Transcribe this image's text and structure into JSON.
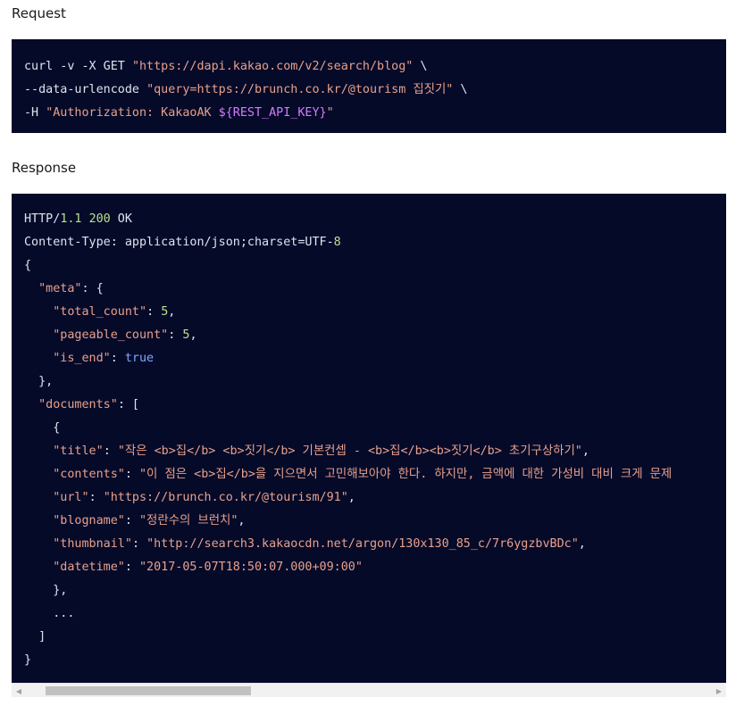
{
  "request": {
    "label": "Request",
    "lines": [
      [
        "curl -v -X GET ",
        "\"https://dapi.kakao.com/v2/search/blog\"",
        " \\"
      ],
      [
        "--data-urlencode ",
        "\"query=https://brunch.co.kr/@tourism 집짓기\"",
        " \\"
      ],
      [
        "-H ",
        "\"Authorization: KakaoAK ",
        "${REST_API_KEY}",
        "\""
      ]
    ]
  },
  "response": {
    "label": "Response",
    "status": {
      "protocol": "HTTP/",
      "version": "1.1",
      "code": "200",
      "text": " OK"
    },
    "content_type": {
      "prefix": "Content-Type: application/json;charset=UTF-",
      "num": "8"
    },
    "meta": {
      "key": "\"meta\"",
      "total_count_key": "\"total_count\"",
      "total_count": "5",
      "pageable_count_key": "\"pageable_count\"",
      "pageable_count": "5",
      "is_end_key": "\"is_end\"",
      "is_end": "true"
    },
    "documents_key": "\"documents\"",
    "document": {
      "title_key": "\"title\"",
      "title": "\"작은 <b>집</b> <b>짓기</b> 기본컨셉 - <b>집</b><b>짓기</b> 초기구상하기\"",
      "contents_key": "\"contents\"",
      "contents": "\"이 점은 <b>집</b>을 지으면서 고민해보아야 한다. 하지만, 금액에 대한 가성비 대비 크게 문제",
      "url_key": "\"url\"",
      "url": "\"https://brunch.co.kr/@tourism/91\"",
      "blogname_key": "\"blogname\"",
      "blogname": "\"정란수의 브런치\"",
      "thumbnail_key": "\"thumbnail\"",
      "thumbnail": "\"http://search3.kakaocdn.net/argon/130x130_85_c/7r6ygzbvBDc\"",
      "datetime_key": "\"datetime\"",
      "datetime": "\"2017-05-07T18:50:07.000+09:00\""
    },
    "ellipsis": "..."
  },
  "scrollbar": {
    "left_arrow": "◀",
    "right_arrow": "▶",
    "position": 0.04,
    "thumb_fraction": 0.3
  },
  "colors": {
    "code_bg": "#050a29",
    "string": "#e8a08a",
    "key": "#c3d1ff",
    "number": "#b9e08e",
    "keyword": "#7fa7ff",
    "variable": "#d779ff"
  }
}
